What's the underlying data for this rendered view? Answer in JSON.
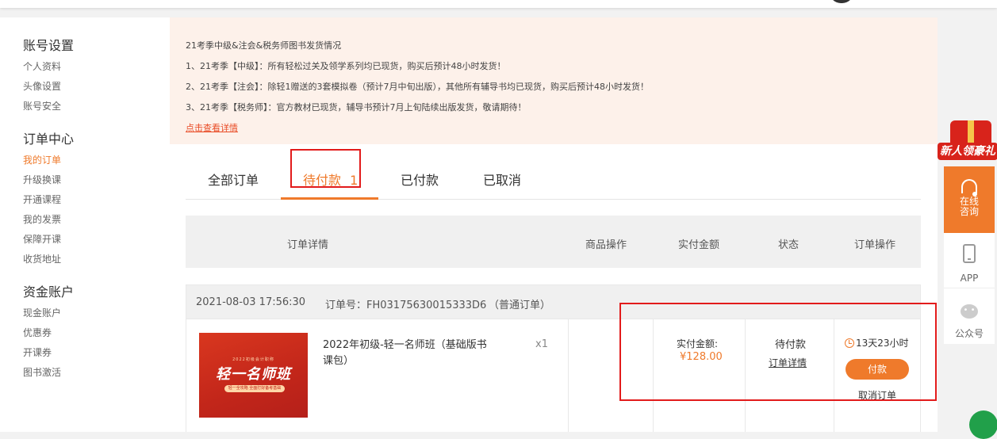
{
  "sidebar": {
    "groups": [
      {
        "title": "账号设置",
        "items": [
          "个人资料",
          "头像设置",
          "账号安全"
        ]
      },
      {
        "title": "订单中心",
        "items": [
          "我的订单",
          "升级换课",
          "开通课程",
          "我的发票",
          "保障开课",
          "收货地址"
        ]
      },
      {
        "title": "资金账户",
        "items": [
          "现金账户",
          "优惠券",
          "开课券",
          "图书激活"
        ]
      }
    ],
    "active_item": "我的订单"
  },
  "notice": {
    "title": "21考季中级&注会&税务师图书发货情况",
    "lines": [
      "1、21考季【中级】：所有轻松过关及领学系列均已现货，购买后预计48小时发货！",
      "2、21考季【注会】：除轻1赠送的3套模拟卷（预计7月中旬出版），其他所有辅导书均已现货，购买后预计48小时发货！",
      "3、21考季【税务师】：官方教材已现货，辅导书预计7月上旬陆续出版发货，敬请期待！"
    ],
    "link": "点击查看详情"
  },
  "tabs": {
    "all": "全部订单",
    "pending": "待付款",
    "pending_count": "1",
    "paid": "已付款",
    "cancelled": "已取消"
  },
  "table_header": {
    "detail": "订单详情",
    "product_ops": "商品操作",
    "paid_amount": "实付金额",
    "status": "状态",
    "order_ops": "订单操作"
  },
  "order": {
    "datetime": "2021-08-03 17:56:30",
    "order_no": "订单号：FH03175630015333D6",
    "order_type": "（普通订单）",
    "product": {
      "name": "2022年初级-轻一名师班（基础版书课包）",
      "qty": "x1",
      "thumb_tiny": "2022初级会计职称",
      "thumb_big": "轻一名师班",
      "thumb_pill": "轻一全攻略 全面打好备考基础"
    },
    "pay_label": "实付金额:",
    "pay_amount": "¥128.00",
    "status": "待付款",
    "detail_link": "订单详情",
    "countdown": "13天23小时",
    "pay_button": "付款",
    "cancel_link": "取消订单"
  },
  "rail": {
    "gift_label": "新人领豪礼",
    "consult": [
      "在线",
      "咨询"
    ],
    "app": "APP",
    "official": "公众号"
  },
  "colors": {
    "accent": "#ef7a2b",
    "highlight_box": "#e21b1b",
    "notice_bg": "#fdf1ea"
  }
}
